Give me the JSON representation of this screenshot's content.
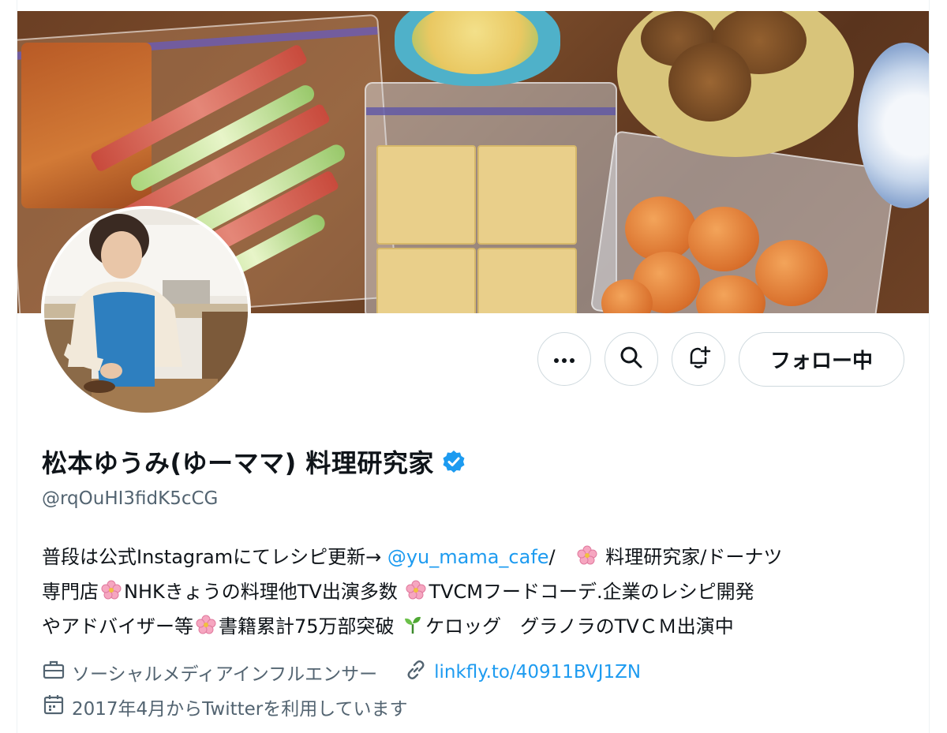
{
  "banner": {
    "description_icon": "banner-food-photo"
  },
  "profile": {
    "display_name": "松本ゆうみ(ゆーママ) 料理研究家",
    "handle": "@rqOuHI3fidK5cCG",
    "verified": true
  },
  "actions": {
    "more_icon": "more-icon",
    "search_icon": "search-icon",
    "notify_icon": "notification-bell-icon",
    "follow_label": "フォロー中"
  },
  "bio": {
    "line1_text": "普段は公式Instagramにてレシピ更新→ ",
    "line1_link": "@yu_mama_cafe",
    "line1_after": "/　",
    "line1_tail": " 料理研究家/ドーナツ",
    "line2_a": "専門店",
    "line2_b": "NHKきょうの料理他TV出演多数 ",
    "line2_c": "TVCMフードコーデ.企業のレシピ開発",
    "line3_a": "やアドバイザー等",
    "line3_b": "書籍累計75万部突破 ",
    "line3_c": "ケロッグ　グラノラのTVＣＭ出演中"
  },
  "meta": {
    "category": "ソーシャルメディアインフルエンサー",
    "link": "linkfly.to/40911BVJ1ZN",
    "joined": "2017年4月からTwitterを利用しています"
  },
  "colors": {
    "accent": "#1d9bf0",
    "text": "#0f1419",
    "secondary": "#536471",
    "border": "#cfd9de"
  }
}
